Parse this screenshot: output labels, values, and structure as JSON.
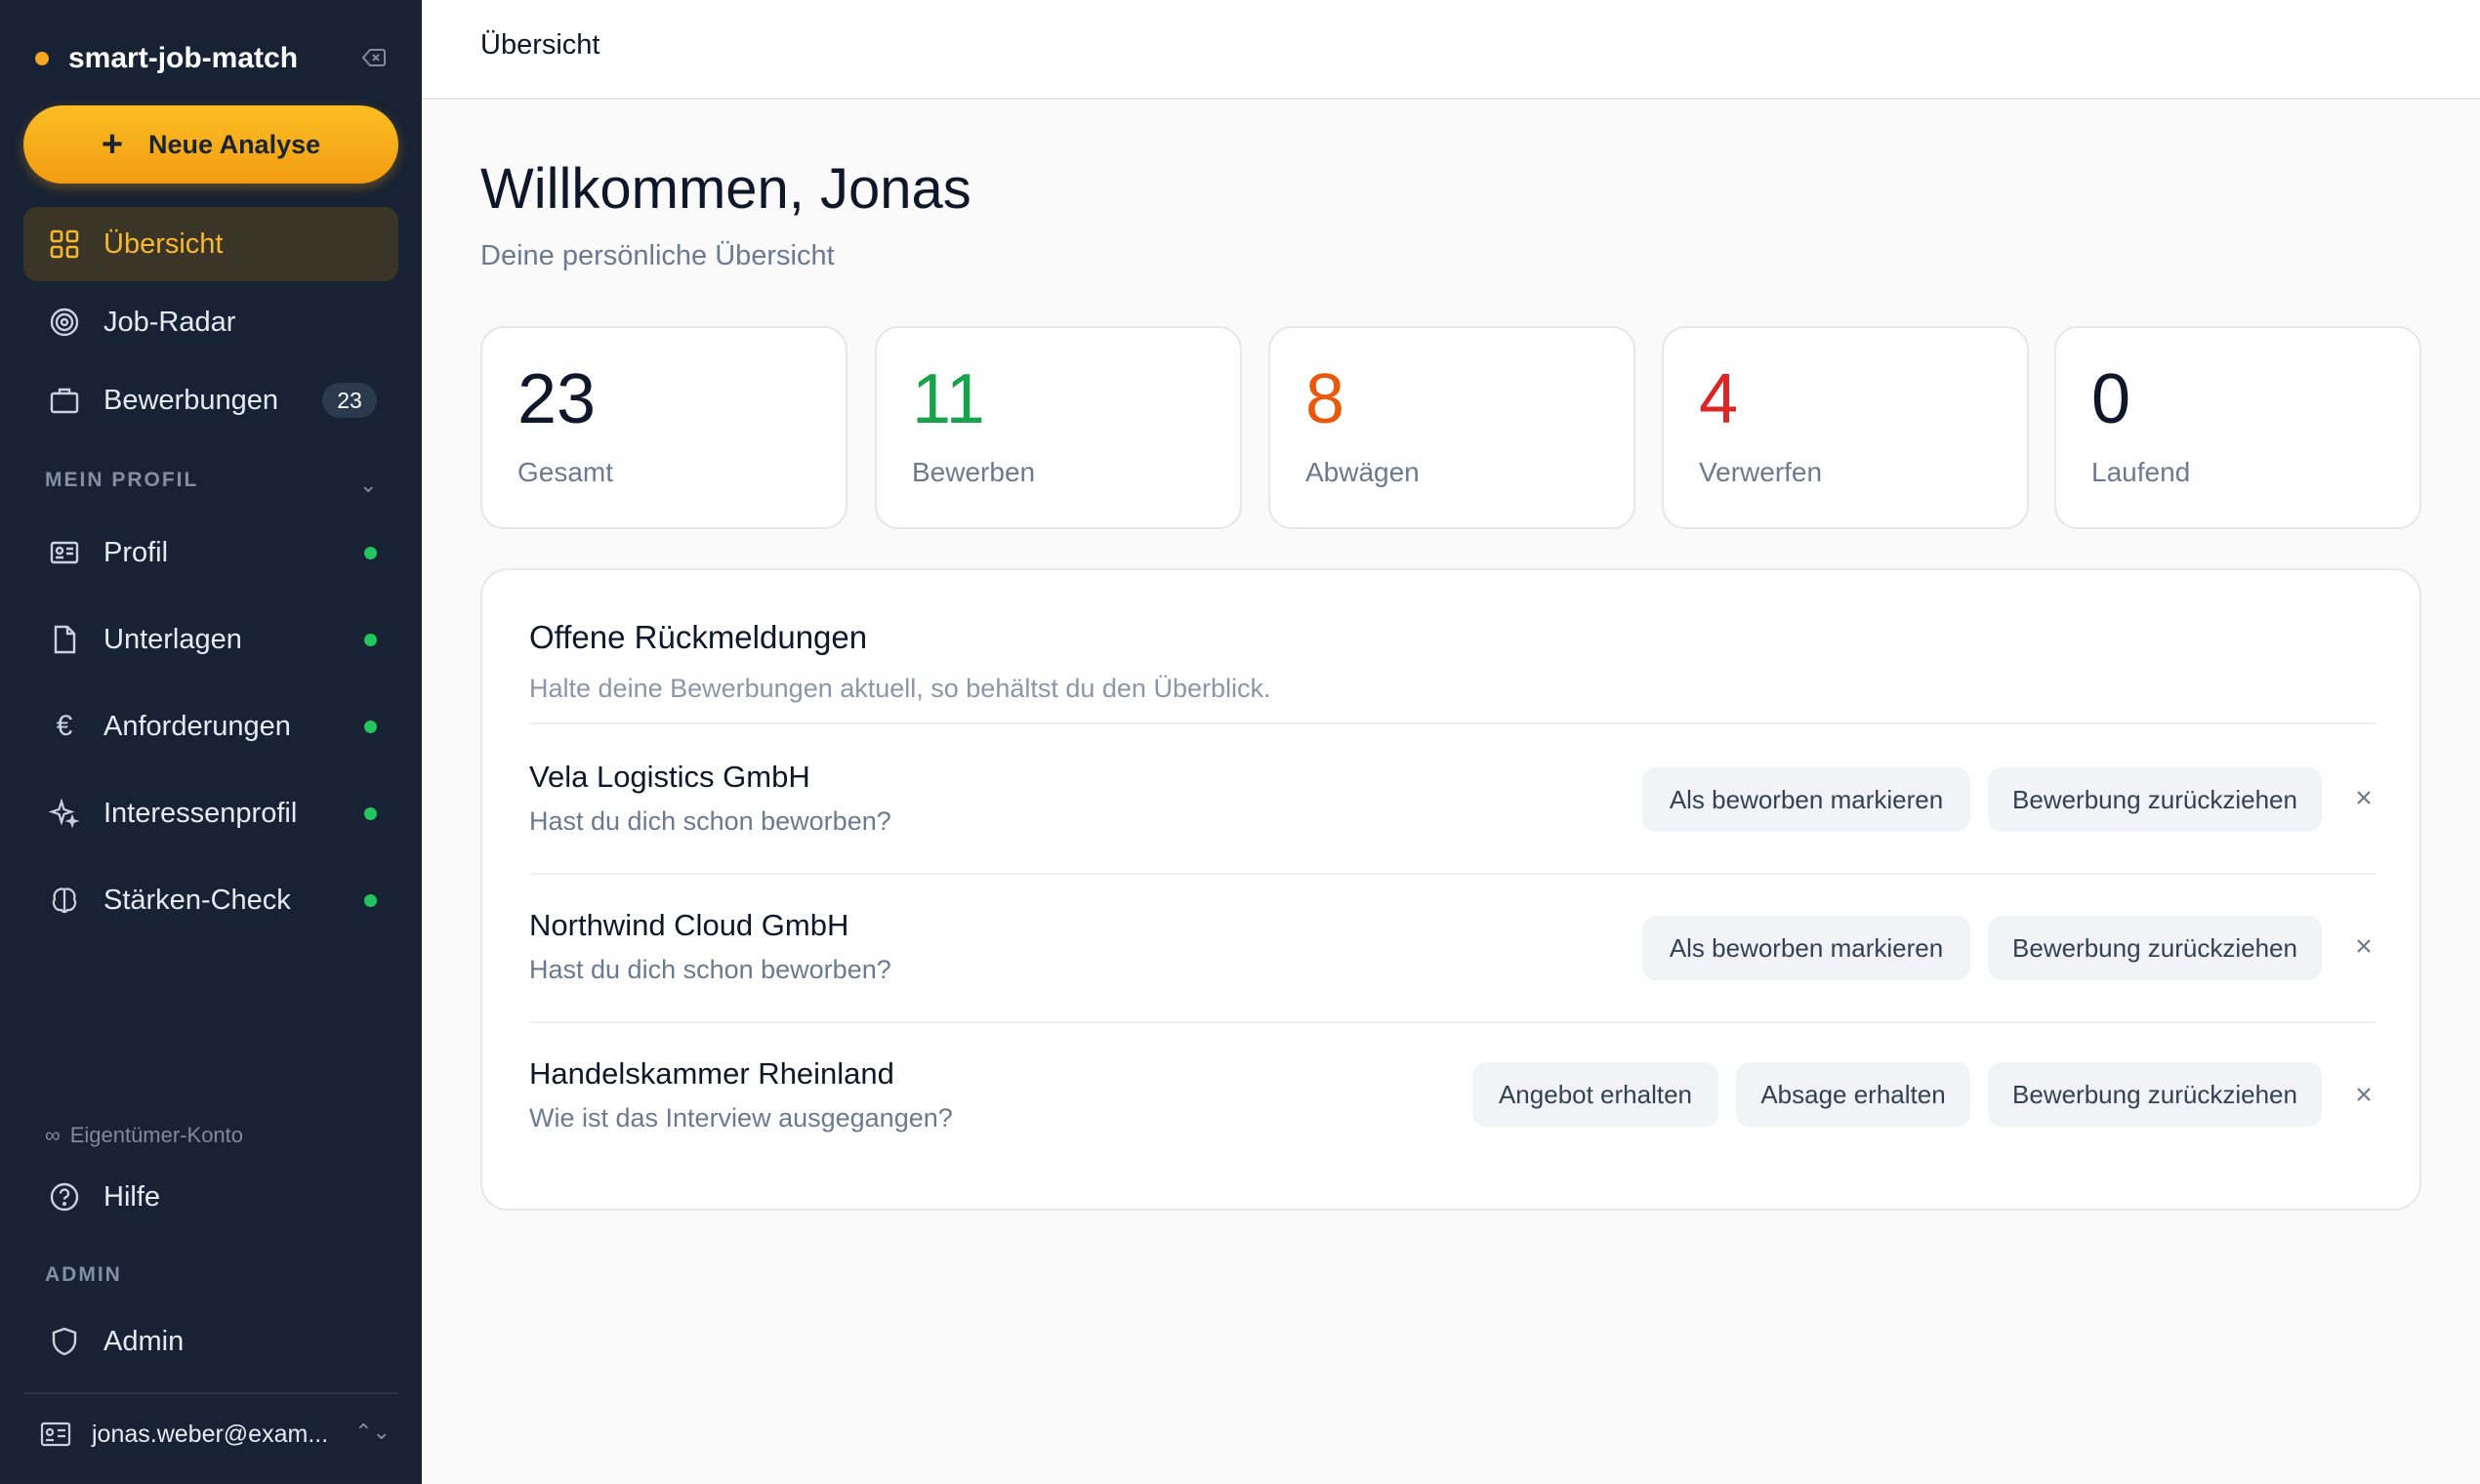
{
  "app": {
    "name": "smart-job-match"
  },
  "sidebar": {
    "new_analysis_label": "Neue Analyse",
    "nav": [
      {
        "label": "Übersicht",
        "icon": "grid-icon",
        "active": true
      },
      {
        "label": "Job-Radar",
        "icon": "radar-icon"
      },
      {
        "label": "Bewerbungen",
        "icon": "briefcase-icon",
        "badge": "23"
      }
    ],
    "profile_section_label": "MEIN PROFIL",
    "profile_items": [
      {
        "label": "Profil",
        "icon": "id-card-icon",
        "status": "complete"
      },
      {
        "label": "Unterlagen",
        "icon": "document-icon",
        "status": "complete"
      },
      {
        "label": "Anforderungen",
        "icon": "euro-icon",
        "status": "complete"
      },
      {
        "label": "Interessenprofil",
        "icon": "sparkle-icon",
        "status": "complete"
      },
      {
        "label": "Stärken-Check",
        "icon": "brain-icon",
        "status": "complete"
      }
    ],
    "owner_account_label": "Eigentümer-Konto",
    "help_label": "Hilfe",
    "admin_section_label": "ADMIN",
    "admin_label": "Admin",
    "user_email": "jonas.weber@exam..."
  },
  "header": {
    "title": "Übersicht"
  },
  "main": {
    "greeting": "Willkommen, Jonas",
    "subtitle": "Deine persönliche Übersicht",
    "stats": [
      {
        "value": "23",
        "label": "Gesamt",
        "color": "#0f172a"
      },
      {
        "value": "11",
        "label": "Bewerben",
        "color": "#16a34a"
      },
      {
        "value": "8",
        "label": "Abwägen",
        "color": "#ea580c"
      },
      {
        "value": "4",
        "label": "Verwerfen",
        "color": "#dc2626"
      },
      {
        "value": "0",
        "label": "Laufend",
        "color": "#0f172a"
      }
    ],
    "feedback": {
      "title": "Offene Rückmeldungen",
      "subtitle": "Halte deine Bewerbungen aktuell, so behältst du den Überblick.",
      "rows": [
        {
          "company": "Vela Logistics GmbH",
          "question": "Hast du dich schon beworben?",
          "actions": [
            "Als beworben markieren",
            "Bewerbung zurückziehen"
          ]
        },
        {
          "company": "Northwind Cloud GmbH",
          "question": "Hast du dich schon beworben?",
          "actions": [
            "Als beworben markieren",
            "Bewerbung zurückziehen"
          ]
        },
        {
          "company": "Handelskammer Rheinland",
          "question": "Wie ist das Interview ausgegangen?",
          "actions": [
            "Angebot erhalten",
            "Absage erhalten",
            "Bewerbung zurückziehen"
          ]
        }
      ]
    }
  },
  "colors": {
    "sidebar_bg": "#172234",
    "accent": "#f5a623",
    "success": "#22c55e"
  }
}
